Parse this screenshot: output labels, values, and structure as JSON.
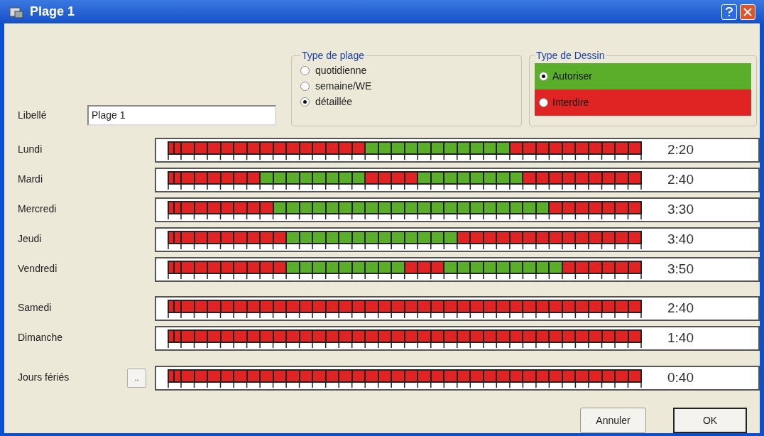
{
  "window": {
    "title": "Plage 1"
  },
  "label_field": {
    "label": "Libellé",
    "value": "Plage 1"
  },
  "range_type": {
    "title": "Type de plage",
    "options": [
      {
        "label": "quotidienne",
        "selected": false
      },
      {
        "label": "semaine/WE",
        "selected": false
      },
      {
        "label": "détaillée",
        "selected": true
      }
    ]
  },
  "draw_type": {
    "title": "Type de Dessin",
    "options": [
      {
        "label": "Autoriser",
        "kind": "allow",
        "selected": true
      },
      {
        "label": "Interdire",
        "kind": "deny",
        "selected": false
      }
    ]
  },
  "days": [
    {
      "label": "Lundi",
      "duration": "2:20",
      "cells": [
        {
          "allowed": false
        },
        {
          "allowed": false
        },
        {
          "allowed": false
        },
        {
          "allowed": false
        },
        {
          "allowed": false
        },
        {
          "allowed": false
        },
        {
          "allowed": false
        },
        {
          "allowed": false
        },
        {
          "allowed": false
        },
        {
          "allowed": false
        },
        {
          "allowed": false
        },
        {
          "allowed": false
        },
        {
          "allowed": false
        },
        {
          "allowed": false
        },
        {
          "allowed": false
        },
        {
          "allowed": false
        },
        {
          "allowed": true
        },
        {
          "allowed": true
        },
        {
          "allowed": true
        },
        {
          "allowed": true
        },
        {
          "allowed": true
        },
        {
          "allowed": true
        },
        {
          "allowed": true
        },
        {
          "allowed": true
        },
        {
          "allowed": true
        },
        {
          "allowed": true
        },
        {
          "allowed": true
        },
        {
          "allowed": false
        },
        {
          "allowed": false
        },
        {
          "allowed": false
        },
        {
          "allowed": false
        },
        {
          "allowed": false
        },
        {
          "allowed": false
        },
        {
          "allowed": false
        },
        {
          "allowed": false
        },
        {
          "allowed": false
        },
        {
          "allowed": false
        }
      ]
    },
    {
      "label": "Mardi",
      "duration": "2:40",
      "cells": [
        {
          "allowed": false
        },
        {
          "allowed": false
        },
        {
          "allowed": false
        },
        {
          "allowed": false
        },
        {
          "allowed": false
        },
        {
          "allowed": false
        },
        {
          "allowed": false
        },
        {
          "allowed": false
        },
        {
          "allowed": true
        },
        {
          "allowed": true
        },
        {
          "allowed": true
        },
        {
          "allowed": true
        },
        {
          "allowed": true
        },
        {
          "allowed": true
        },
        {
          "allowed": true
        },
        {
          "allowed": true
        },
        {
          "allowed": false
        },
        {
          "allowed": false
        },
        {
          "allowed": false
        },
        {
          "allowed": false
        },
        {
          "allowed": true
        },
        {
          "allowed": true
        },
        {
          "allowed": true
        },
        {
          "allowed": true
        },
        {
          "allowed": true
        },
        {
          "allowed": true
        },
        {
          "allowed": true
        },
        {
          "allowed": true
        },
        {
          "allowed": false
        },
        {
          "allowed": false
        },
        {
          "allowed": false
        },
        {
          "allowed": false
        },
        {
          "allowed": false
        },
        {
          "allowed": false
        },
        {
          "allowed": false
        },
        {
          "allowed": false
        },
        {
          "allowed": false
        }
      ]
    },
    {
      "label": "Mercredi",
      "duration": "3:30",
      "cells": [
        {
          "allowed": false
        },
        {
          "allowed": false
        },
        {
          "allowed": false
        },
        {
          "allowed": false
        },
        {
          "allowed": false
        },
        {
          "allowed": false
        },
        {
          "allowed": false
        },
        {
          "allowed": false
        },
        {
          "allowed": false
        },
        {
          "allowed": true
        },
        {
          "allowed": true
        },
        {
          "allowed": true
        },
        {
          "allowed": true
        },
        {
          "allowed": true
        },
        {
          "allowed": true
        },
        {
          "allowed": true
        },
        {
          "allowed": true
        },
        {
          "allowed": true
        },
        {
          "allowed": true
        },
        {
          "allowed": true
        },
        {
          "allowed": true
        },
        {
          "allowed": true
        },
        {
          "allowed": true
        },
        {
          "allowed": true
        },
        {
          "allowed": true
        },
        {
          "allowed": true
        },
        {
          "allowed": true
        },
        {
          "allowed": true
        },
        {
          "allowed": true
        },
        {
          "allowed": true
        },
        {
          "allowed": false
        },
        {
          "allowed": false
        },
        {
          "allowed": false
        },
        {
          "allowed": false
        },
        {
          "allowed": false
        },
        {
          "allowed": false
        },
        {
          "allowed": false
        }
      ]
    },
    {
      "label": "Jeudi",
      "duration": "3:40",
      "cells": [
        {
          "allowed": false
        },
        {
          "allowed": false
        },
        {
          "allowed": false
        },
        {
          "allowed": false
        },
        {
          "allowed": false
        },
        {
          "allowed": false
        },
        {
          "allowed": false
        },
        {
          "allowed": false
        },
        {
          "allowed": false
        },
        {
          "allowed": false
        },
        {
          "allowed": true
        },
        {
          "allowed": true
        },
        {
          "allowed": true
        },
        {
          "allowed": true
        },
        {
          "allowed": true
        },
        {
          "allowed": true
        },
        {
          "allowed": true
        },
        {
          "allowed": true
        },
        {
          "allowed": true
        },
        {
          "allowed": true
        },
        {
          "allowed": true
        },
        {
          "allowed": true
        },
        {
          "allowed": true
        },
        {
          "allowed": false
        },
        {
          "allowed": false
        },
        {
          "allowed": false
        },
        {
          "allowed": false
        },
        {
          "allowed": false
        },
        {
          "allowed": false
        },
        {
          "allowed": false
        },
        {
          "allowed": false
        },
        {
          "allowed": false
        },
        {
          "allowed": false
        },
        {
          "allowed": false
        },
        {
          "allowed": false
        },
        {
          "allowed": false
        },
        {
          "allowed": false
        }
      ]
    },
    {
      "label": "Vendredi",
      "duration": "3:50",
      "cells": [
        {
          "allowed": false
        },
        {
          "allowed": false
        },
        {
          "allowed": false
        },
        {
          "allowed": false
        },
        {
          "allowed": false
        },
        {
          "allowed": false
        },
        {
          "allowed": false
        },
        {
          "allowed": false
        },
        {
          "allowed": false
        },
        {
          "allowed": false
        },
        {
          "allowed": true
        },
        {
          "allowed": true
        },
        {
          "allowed": true
        },
        {
          "allowed": true
        },
        {
          "allowed": true
        },
        {
          "allowed": true
        },
        {
          "allowed": true
        },
        {
          "allowed": true
        },
        {
          "allowed": true
        },
        {
          "allowed": false
        },
        {
          "allowed": false
        },
        {
          "allowed": false
        },
        {
          "allowed": true
        },
        {
          "allowed": true
        },
        {
          "allowed": true
        },
        {
          "allowed": true
        },
        {
          "allowed": true
        },
        {
          "allowed": true
        },
        {
          "allowed": true
        },
        {
          "allowed": true
        },
        {
          "allowed": true
        },
        {
          "allowed": false
        },
        {
          "allowed": false
        },
        {
          "allowed": false
        },
        {
          "allowed": false
        },
        {
          "allowed": false
        },
        {
          "allowed": false
        }
      ]
    },
    {
      "label": "Samedi",
      "duration": "2:40",
      "cells": [
        {
          "allowed": false
        },
        {
          "allowed": false
        },
        {
          "allowed": false
        },
        {
          "allowed": false
        },
        {
          "allowed": false
        },
        {
          "allowed": false
        },
        {
          "allowed": false
        },
        {
          "allowed": false
        },
        {
          "allowed": false
        },
        {
          "allowed": false
        },
        {
          "allowed": false
        },
        {
          "allowed": false
        },
        {
          "allowed": false
        },
        {
          "allowed": false
        },
        {
          "allowed": false
        },
        {
          "allowed": false
        },
        {
          "allowed": false
        },
        {
          "allowed": false
        },
        {
          "allowed": false
        },
        {
          "allowed": false
        },
        {
          "allowed": false
        },
        {
          "allowed": false
        },
        {
          "allowed": false
        },
        {
          "allowed": false
        },
        {
          "allowed": false
        },
        {
          "allowed": false
        },
        {
          "allowed": false
        },
        {
          "allowed": false
        },
        {
          "allowed": false
        },
        {
          "allowed": false
        },
        {
          "allowed": false
        },
        {
          "allowed": false
        },
        {
          "allowed": false
        },
        {
          "allowed": false
        },
        {
          "allowed": false
        },
        {
          "allowed": false
        },
        {
          "allowed": false
        }
      ]
    },
    {
      "label": "Dimanche",
      "duration": "1:40",
      "cells": [
        {
          "allowed": false
        },
        {
          "allowed": false
        },
        {
          "allowed": false
        },
        {
          "allowed": false
        },
        {
          "allowed": false
        },
        {
          "allowed": false
        },
        {
          "allowed": false
        },
        {
          "allowed": false
        },
        {
          "allowed": false
        },
        {
          "allowed": false
        },
        {
          "allowed": false
        },
        {
          "allowed": false
        },
        {
          "allowed": false
        },
        {
          "allowed": false
        },
        {
          "allowed": false
        },
        {
          "allowed": false
        },
        {
          "allowed": false
        },
        {
          "allowed": false
        },
        {
          "allowed": false
        },
        {
          "allowed": false
        },
        {
          "allowed": false
        },
        {
          "allowed": false
        },
        {
          "allowed": false
        },
        {
          "allowed": false
        },
        {
          "allowed": false
        },
        {
          "allowed": false
        },
        {
          "allowed": false
        },
        {
          "allowed": false
        },
        {
          "allowed": false
        },
        {
          "allowed": false
        },
        {
          "allowed": false
        },
        {
          "allowed": false
        },
        {
          "allowed": false
        },
        {
          "allowed": false
        },
        {
          "allowed": false
        },
        {
          "allowed": false
        },
        {
          "allowed": false
        }
      ]
    },
    {
      "label": "Jours fériés",
      "duration": "0:40",
      "button": "..",
      "cells": [
        {
          "allowed": false
        },
        {
          "allowed": false
        },
        {
          "allowed": false
        },
        {
          "allowed": false
        },
        {
          "allowed": false
        },
        {
          "allowed": false
        },
        {
          "allowed": false
        },
        {
          "allowed": false
        },
        {
          "allowed": false
        },
        {
          "allowed": false
        },
        {
          "allowed": false
        },
        {
          "allowed": false
        },
        {
          "allowed": false
        },
        {
          "allowed": false
        },
        {
          "allowed": false
        },
        {
          "allowed": false
        },
        {
          "allowed": false
        },
        {
          "allowed": false
        },
        {
          "allowed": false
        },
        {
          "allowed": false
        },
        {
          "allowed": false
        },
        {
          "allowed": false
        },
        {
          "allowed": false
        },
        {
          "allowed": false
        },
        {
          "allowed": false
        },
        {
          "allowed": false
        },
        {
          "allowed": false
        },
        {
          "allowed": false
        },
        {
          "allowed": false
        },
        {
          "allowed": false
        },
        {
          "allowed": false
        },
        {
          "allowed": false
        },
        {
          "allowed": false
        },
        {
          "allowed": false
        },
        {
          "allowed": false
        },
        {
          "allowed": false
        },
        {
          "allowed": false
        }
      ]
    }
  ],
  "buttons": [
    "Annuler",
    "OK"
  ]
}
